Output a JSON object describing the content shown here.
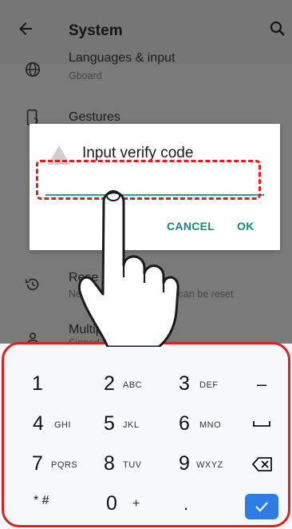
{
  "appbar": {
    "title": "System"
  },
  "settings": {
    "languages": {
      "title": "Languages & input",
      "subtitle": "Gboard"
    },
    "gestures": {
      "title": "Gestures"
    },
    "reset": {
      "title": "Rese",
      "subtitle_start": "Netw",
      "subtitle_end": "ce can be reset"
    },
    "users": {
      "title": "Multiple users",
      "subtitle": "Signed in as Owner"
    }
  },
  "dialog": {
    "title": "Input verify code",
    "value": "",
    "cancel_label": "CANCEL",
    "ok_label": "OK"
  },
  "keyboard": {
    "rows": [
      [
        {
          "num": "1",
          "letters": ""
        },
        {
          "num": "2",
          "letters": "ABC"
        },
        {
          "num": "3",
          "letters": "DEF"
        },
        {
          "sym": "–"
        }
      ],
      [
        {
          "num": "4",
          "letters": "GHI"
        },
        {
          "num": "5",
          "letters": "JKL"
        },
        {
          "num": "6",
          "letters": "MNO"
        },
        {
          "sym": "space"
        }
      ],
      [
        {
          "num": "7",
          "letters": "PQRS"
        },
        {
          "num": "8",
          "letters": "TUV"
        },
        {
          "num": "9",
          "letters": "WXYZ"
        },
        {
          "sym": "backspace"
        }
      ],
      [
        {
          "sym": "* #"
        },
        {
          "num": "0",
          "letters": "+"
        },
        {
          "sym": "."
        },
        {
          "sym": "confirm"
        }
      ]
    ],
    "key_1": "1",
    "key_2": "2",
    "key_2_letters": "ABC",
    "key_3": "3",
    "key_3_letters": "DEF",
    "key_dash": "–",
    "key_4": "4",
    "key_4_letters": "GHI",
    "key_5": "5",
    "key_5_letters": "JKL",
    "key_6": "6",
    "key_6_letters": "MNO",
    "key_7": "7",
    "key_7_letters": "PQRS",
    "key_8": "8",
    "key_8_letters": "TUV",
    "key_9": "9",
    "key_9_letters": "WXYZ",
    "key_star_hash": "* #",
    "key_0": "0",
    "key_0_letters": "+",
    "key_dot": "."
  },
  "colors": {
    "dialog_accent": "#138b7e",
    "highlight": "#e0201b",
    "confirm_key": "#2d7de3"
  },
  "icons": [
    "back-arrow-icon",
    "search-icon",
    "globe-icon",
    "phone-gesture-icon",
    "warning-icon",
    "reset-history-icon",
    "person-icon",
    "space-icon",
    "backspace-icon",
    "checkmark-icon",
    "pointing-hand-icon"
  ]
}
